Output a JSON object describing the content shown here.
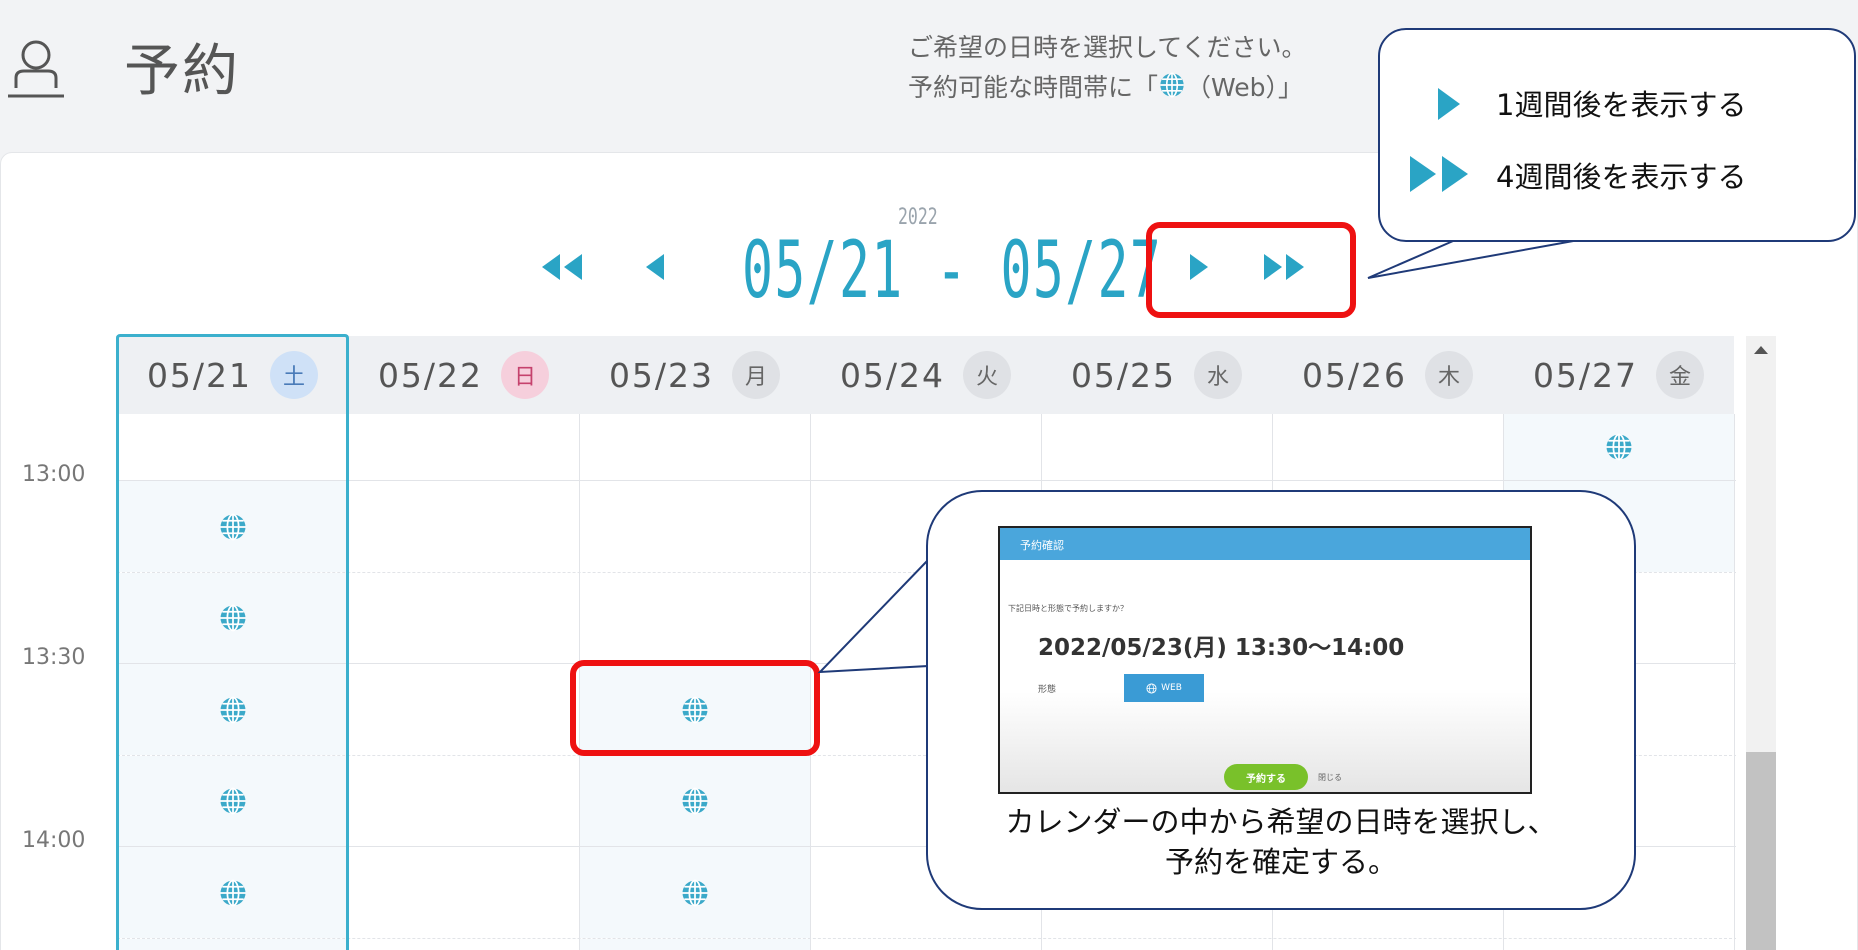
{
  "header": {
    "title": "予約",
    "desc_line1": "ご希望の日時を選択してください。",
    "desc_line2_prefix": "予約可能な時間帯に「",
    "desc_line2_suffix": "（Web）」"
  },
  "week_nav": {
    "year": "2022",
    "range": "05/21 - 05/27"
  },
  "days": [
    {
      "date": "05/21",
      "weekday": "土",
      "badge_color": "#cfe1f7",
      "badge_text_color": "#4a7bb8"
    },
    {
      "date": "05/22",
      "weekday": "日",
      "badge_color": "#f6cfdc",
      "badge_text_color": "#c5426d"
    },
    {
      "date": "05/23",
      "weekday": "月",
      "badge_color": "#dfe1e5",
      "badge_text_color": "#666666"
    },
    {
      "date": "05/24",
      "weekday": "火",
      "badge_color": "#dfe1e5",
      "badge_text_color": "#666666"
    },
    {
      "date": "05/25",
      "weekday": "水",
      "badge_color": "#dfe1e5",
      "badge_text_color": "#666666"
    },
    {
      "date": "05/26",
      "weekday": "木",
      "badge_color": "#dfe1e5",
      "badge_text_color": "#666666"
    },
    {
      "date": "05/27",
      "weekday": "金",
      "badge_color": "#dfe1e5",
      "badge_text_color": "#666666"
    }
  ],
  "time_labels": [
    "13:00",
    "13:30",
    "14:00"
  ],
  "callout_nav": {
    "one_week": "1週間後を表示する",
    "four_weeks": "4週間後を表示する"
  },
  "dialog": {
    "title": "予約確認",
    "question": "下記日時と形態で予約しますか？",
    "datetime": "2022/05/23(月) 13:30〜14:00",
    "format_label": "形態",
    "web_label": "WEB",
    "confirm_label": "予約する",
    "close_label": "閉じる"
  },
  "callout_instruction": {
    "line1": "カレンダーの中から希望の日時を選択し、",
    "line2": "予約を確定する。"
  },
  "colors": {
    "accent": "#2aa4c5",
    "slot_bg": "#f4f9fc",
    "globe": "#3ba9c9",
    "highlight_red": "#ee1111",
    "callout_border": "#1f3a78"
  },
  "icons": {
    "user": "user-icon",
    "globe": "globe-icon",
    "prev_4w": "double-chevron-left-icon",
    "prev_1w": "chevron-left-icon",
    "next_1w": "chevron-right-icon",
    "next_4w": "double-chevron-right-icon"
  }
}
